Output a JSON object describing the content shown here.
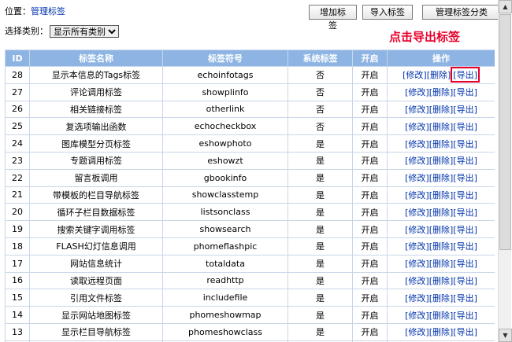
{
  "breadcrumb": {
    "prefix": "位置：",
    "link": "管理标签"
  },
  "buttons": {
    "add": "增加标签",
    "import": "导入标签",
    "manage": "管理标签分类"
  },
  "filter": {
    "label": "选择类别：",
    "selected": "显示所有类别"
  },
  "callout": "点击导出标签",
  "table": {
    "headers": [
      "ID",
      "标签名称",
      "标签符号",
      "系统标签",
      "开启",
      "操作"
    ],
    "ops": {
      "edit": "[修改]",
      "delete": "[删除]",
      "export": "[导出]"
    },
    "rows": [
      {
        "id": "28",
        "name": "显示本信息的Tags标签",
        "symbol": "echoinfotags",
        "system": "否",
        "enabled": "开启"
      },
      {
        "id": "27",
        "name": "评论调用标签",
        "symbol": "showplinfo",
        "system": "否",
        "enabled": "开启"
      },
      {
        "id": "26",
        "name": "相关链接标签",
        "symbol": "otherlink",
        "system": "否",
        "enabled": "开启"
      },
      {
        "id": "25",
        "name": "复选项输出函数",
        "symbol": "echocheckbox",
        "system": "否",
        "enabled": "开启"
      },
      {
        "id": "24",
        "name": "图库模型分页标签",
        "symbol": "eshowphoto",
        "system": "是",
        "enabled": "开启"
      },
      {
        "id": "23",
        "name": "专题调用标签",
        "symbol": "eshowzt",
        "system": "是",
        "enabled": "开启"
      },
      {
        "id": "22",
        "name": "留言板调用",
        "symbol": "gbookinfo",
        "system": "是",
        "enabled": "开启"
      },
      {
        "id": "21",
        "name": "带模板的栏目导航标签",
        "symbol": "showclasstemp",
        "system": "是",
        "enabled": "开启"
      },
      {
        "id": "20",
        "name": "循环子栏目数据标签",
        "symbol": "listsonclass",
        "system": "是",
        "enabled": "开启"
      },
      {
        "id": "19",
        "name": "搜索关键字调用标签",
        "symbol": "showsearch",
        "system": "是",
        "enabled": "开启"
      },
      {
        "id": "18",
        "name": "FLASH幻灯信息调用",
        "symbol": "phomeflashpic",
        "system": "是",
        "enabled": "开启"
      },
      {
        "id": "17",
        "name": "网站信息统计",
        "symbol": "totaldata",
        "system": "是",
        "enabled": "开启"
      },
      {
        "id": "16",
        "name": "读取远程页面",
        "symbol": "readhttp",
        "system": "是",
        "enabled": "开启"
      },
      {
        "id": "15",
        "name": "引用文件标签",
        "symbol": "includefile",
        "system": "是",
        "enabled": "开启"
      },
      {
        "id": "14",
        "name": "显示网站地图标签",
        "symbol": "phomeshowmap",
        "system": "是",
        "enabled": "开启"
      },
      {
        "id": "13",
        "name": "显示栏目导航标签",
        "symbol": "phomeshowclass",
        "system": "是",
        "enabled": "开启"
      },
      {
        "id": "",
        "name": "",
        "symbol": "",
        "system": "",
        "enabled": ""
      }
    ]
  },
  "scrollbar": {
    "up_icon": "arrow-up",
    "down_icon": "arrow-down"
  }
}
